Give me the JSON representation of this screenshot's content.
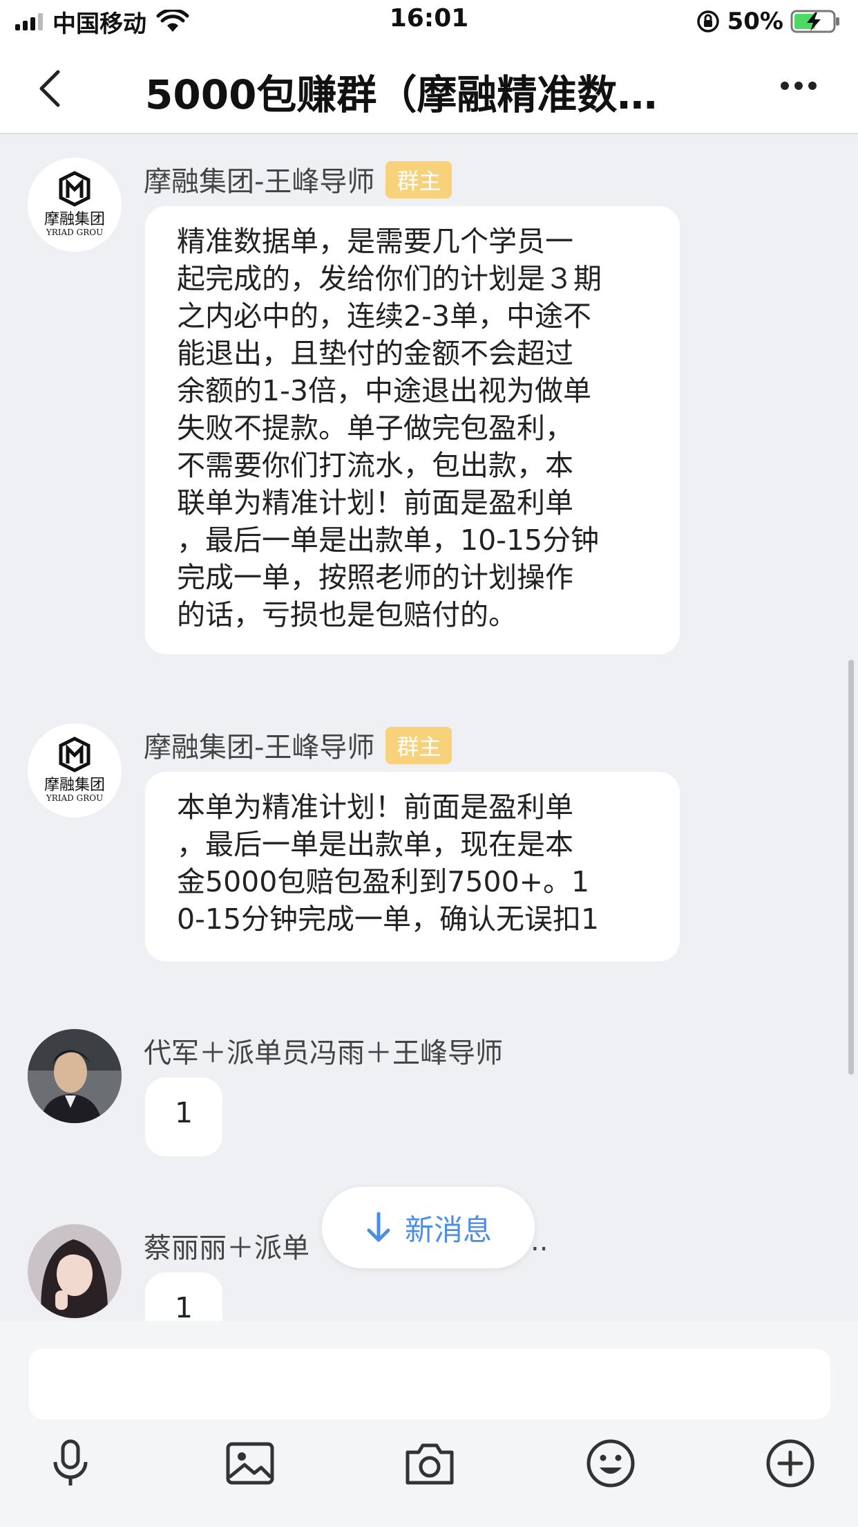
{
  "status_bar": {
    "carrier": "中国移动",
    "time": "16:01",
    "battery_percent": "50%"
  },
  "nav": {
    "title": "5000包赚群（摩融精准数…"
  },
  "messages": [
    {
      "sender": "摩融集团-王峰导师",
      "badge": "群主",
      "avatar_text": "摩融集团",
      "avatar_subtext": "YRIAD GROU",
      "text": "精准数据单，是需要几个学员一\n起完成的，发给你们的计划是３期\n之内必中的，连续2-3单，中途不\n能退出，且垫付的金额不会超过\n余额的1-3倍，中途退出视为做单\n失败不提款。单子做完包盈利，\n不需要你们打流水，包出款，本\n联单为精准计划！前面是盈利单\n，最后一单是出款单，10-15分钟\n完成一单，按照老师的计划操作\n的话，亏损也是包赔付的。"
    },
    {
      "sender": "摩融集团-王峰导师",
      "badge": "群主",
      "avatar_text": "摩融集团",
      "avatar_subtext": "YRIAD GROU",
      "text": "本单为精准计划！前面是盈利单\n，最后一单是出款单，现在是本\n金5000包赔包盈利到7500+。1\n0-15分钟完成一单，确认无误扣1"
    },
    {
      "sender": "代军＋派单员冯雨＋王峰导师",
      "text": "1"
    },
    {
      "sender": "蔡丽丽＋派单",
      "sender_tail": "..",
      "text": "1"
    }
  ],
  "new_message_button": "新消息",
  "toolbar_icons": [
    "microphone-icon",
    "image-icon",
    "camera-icon",
    "emoji-icon",
    "plus-icon"
  ],
  "colors": {
    "badge": "#f7d27a",
    "link_blue": "#4b8ee6",
    "chat_background": "#eef0f3"
  }
}
